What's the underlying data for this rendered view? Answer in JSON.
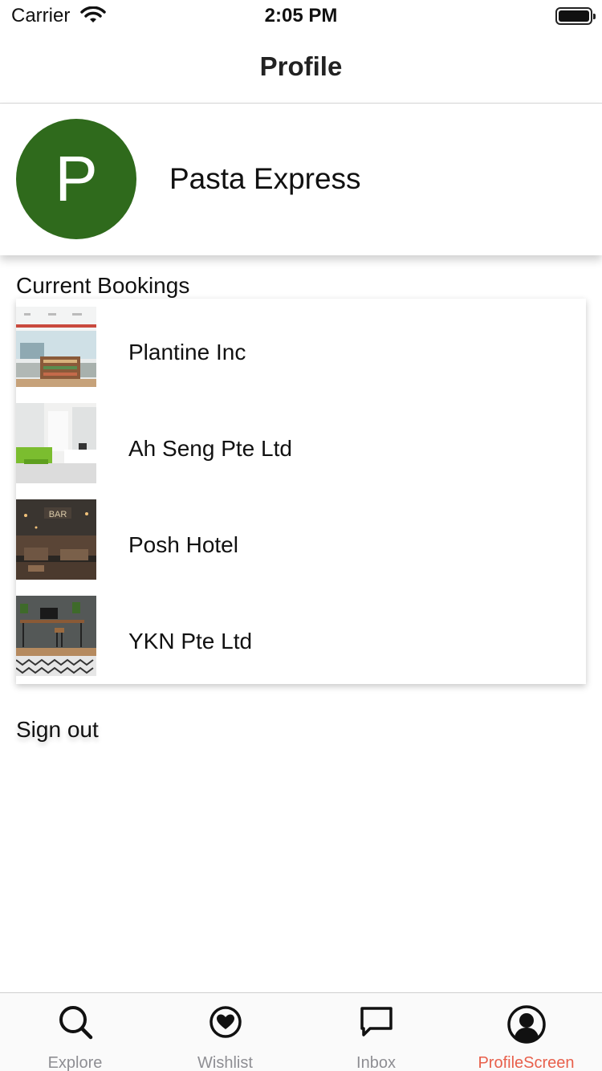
{
  "status_bar": {
    "carrier": "Carrier",
    "time": "2:05 PM",
    "battery_level": 1.0
  },
  "nav": {
    "title": "Profile"
  },
  "profile": {
    "avatar_letter": "P",
    "name": "Pasta Express",
    "avatar_color": "#2f6a1c"
  },
  "bookings": {
    "section_title": "Current Bookings",
    "items": [
      {
        "name": "Plantine Inc"
      },
      {
        "name": "Ah Seng Pte Ltd"
      },
      {
        "name": "Posh Hotel"
      },
      {
        "name": "YKN Pte Ltd"
      }
    ]
  },
  "actions": {
    "sign_out": "Sign out"
  },
  "tabs": [
    {
      "label": "Explore",
      "icon": "search-icon",
      "active": false
    },
    {
      "label": "Wishlist",
      "icon": "heart-circle-icon",
      "active": false
    },
    {
      "label": "Inbox",
      "icon": "chat-bubble-icon",
      "active": false
    },
    {
      "label": "ProfileScreen",
      "icon": "user-circle-icon",
      "active": true
    }
  ],
  "colors": {
    "accent": "#e8604c",
    "inactive_tab": "#8e8e93"
  }
}
